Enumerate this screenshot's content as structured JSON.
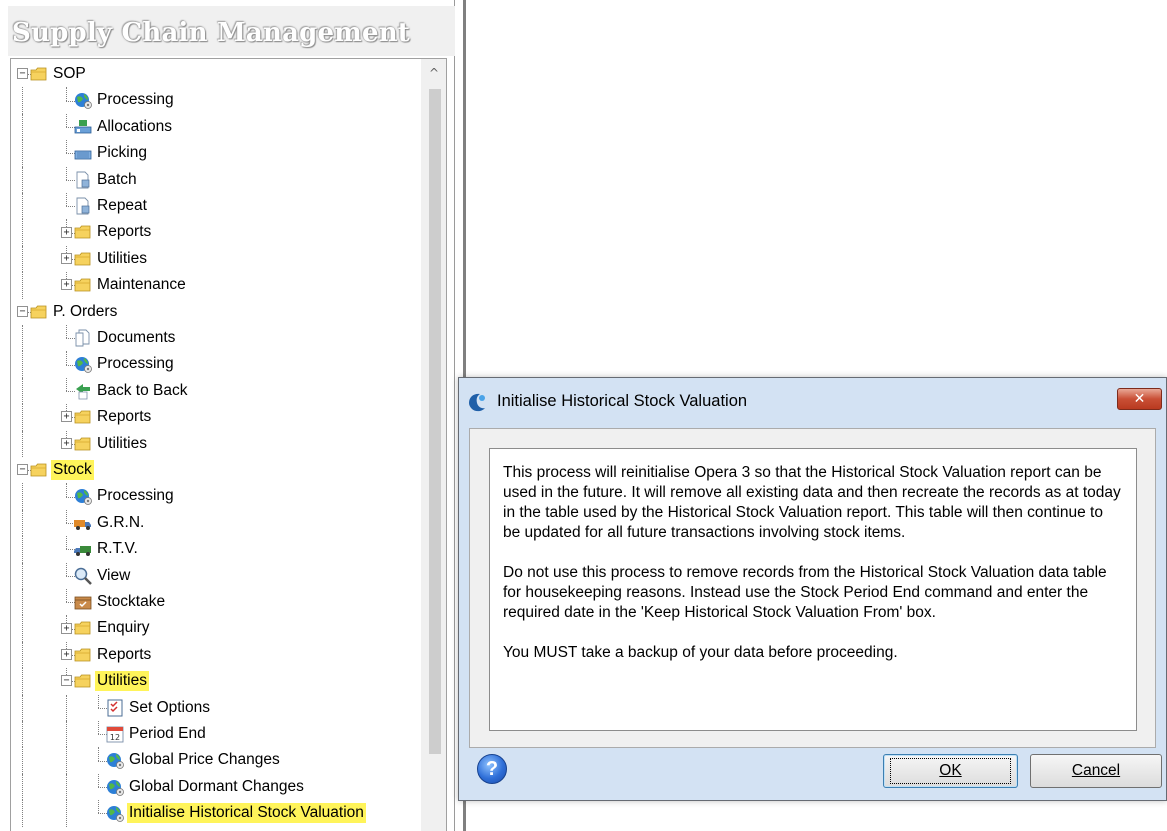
{
  "panel": {
    "title": "Supply Chain Management",
    "tree": [
      {
        "label": "SOP",
        "icon": "folder-icon",
        "level": 0,
        "expander": "−",
        "highlight": false
      },
      {
        "label": "Processing",
        "icon": "processing-globe-icon",
        "level": 1,
        "expander": "",
        "highlight": false
      },
      {
        "label": "Allocations",
        "icon": "allocations-icon",
        "level": 1,
        "expander": "",
        "highlight": false
      },
      {
        "label": "Picking",
        "icon": "picking-icon",
        "level": 1,
        "expander": "",
        "highlight": false
      },
      {
        "label": "Batch",
        "icon": "document-icon",
        "level": 1,
        "expander": "",
        "highlight": false
      },
      {
        "label": "Repeat",
        "icon": "document-icon",
        "level": 1,
        "expander": "",
        "highlight": false
      },
      {
        "label": "Reports",
        "icon": "folder-icon",
        "level": 1,
        "expander": "+",
        "highlight": false
      },
      {
        "label": "Utilities",
        "icon": "folder-icon",
        "level": 1,
        "expander": "+",
        "highlight": false
      },
      {
        "label": "Maintenance",
        "icon": "folder-icon",
        "level": 1,
        "expander": "+",
        "highlight": false
      },
      {
        "label": "P. Orders",
        "icon": "folder-icon",
        "level": 0,
        "expander": "−",
        "highlight": false
      },
      {
        "label": "Documents",
        "icon": "documents-icon",
        "level": 1,
        "expander": "",
        "highlight": false
      },
      {
        "label": "Processing",
        "icon": "processing-globe-icon",
        "level": 1,
        "expander": "",
        "highlight": false
      },
      {
        "label": "Back to Back",
        "icon": "back-to-back-icon",
        "level": 1,
        "expander": "",
        "highlight": false
      },
      {
        "label": "Reports",
        "icon": "folder-icon",
        "level": 1,
        "expander": "+",
        "highlight": false
      },
      {
        "label": "Utilities",
        "icon": "folder-icon",
        "level": 1,
        "expander": "+",
        "highlight": false
      },
      {
        "label": "Stock",
        "icon": "folder-icon",
        "level": 0,
        "expander": "−",
        "highlight": true
      },
      {
        "label": "Processing",
        "icon": "processing-globe-icon",
        "level": 1,
        "expander": "",
        "highlight": false
      },
      {
        "label": "G.R.N.",
        "icon": "truck-icon",
        "level": 1,
        "expander": "",
        "highlight": false
      },
      {
        "label": "R.T.V.",
        "icon": "return-truck-icon",
        "level": 1,
        "expander": "",
        "highlight": false
      },
      {
        "label": "View",
        "icon": "magnifier-icon",
        "level": 1,
        "expander": "",
        "highlight": false
      },
      {
        "label": "Stocktake",
        "icon": "stocktake-box-icon",
        "level": 1,
        "expander": "",
        "highlight": false
      },
      {
        "label": "Enquiry",
        "icon": "folder-icon",
        "level": 1,
        "expander": "+",
        "highlight": false
      },
      {
        "label": "Reports",
        "icon": "folder-icon",
        "level": 1,
        "expander": "+",
        "highlight": false
      },
      {
        "label": "Utilities",
        "icon": "folder-icon",
        "level": 1,
        "expander": "−",
        "highlight": true
      },
      {
        "label": "Set Options",
        "icon": "checklist-icon",
        "level": 2,
        "expander": "",
        "highlight": false
      },
      {
        "label": "Period End",
        "icon": "calendar-icon",
        "level": 2,
        "expander": "",
        "highlight": false
      },
      {
        "label": "Global Price Changes",
        "icon": "processing-globe-icon",
        "level": 2,
        "expander": "",
        "highlight": false
      },
      {
        "label": "Global Dormant Changes",
        "icon": "processing-globe-icon",
        "level": 2,
        "expander": "",
        "highlight": false
      },
      {
        "label": "Initialise Historical Stock Valuation",
        "icon": "processing-globe-icon",
        "level": 2,
        "expander": "",
        "highlight": true
      }
    ],
    "scroll_up_glyph": "^"
  },
  "dialog": {
    "title": "Initialise Historical Stock Valuation",
    "close_glyph": "✕",
    "paragraphs": [
      "This process will reinitialise Opera 3 so that the Historical Stock Valuation report can be used in the future. It will remove all existing data and then recreate the records as at today in the table used by the Historical Stock Valuation report. This table will then continue to be updated for all future transactions involving stock items.",
      "Do not use this process to remove records from the Historical Stock Valuation data table for housekeeping reasons. Instead use the Stock Period End command and enter the required date in the 'Keep Historical Stock Valuation From' box.",
      "You MUST take a backup of your data before proceeding."
    ],
    "help_glyph": "?",
    "ok_label": "OK",
    "cancel_label": "Cancel"
  },
  "colors": {
    "highlight": "#fff45a",
    "dialog_frame": "#d3e2f3",
    "close_button": "#c94f35",
    "folder": "#f2c94c"
  }
}
